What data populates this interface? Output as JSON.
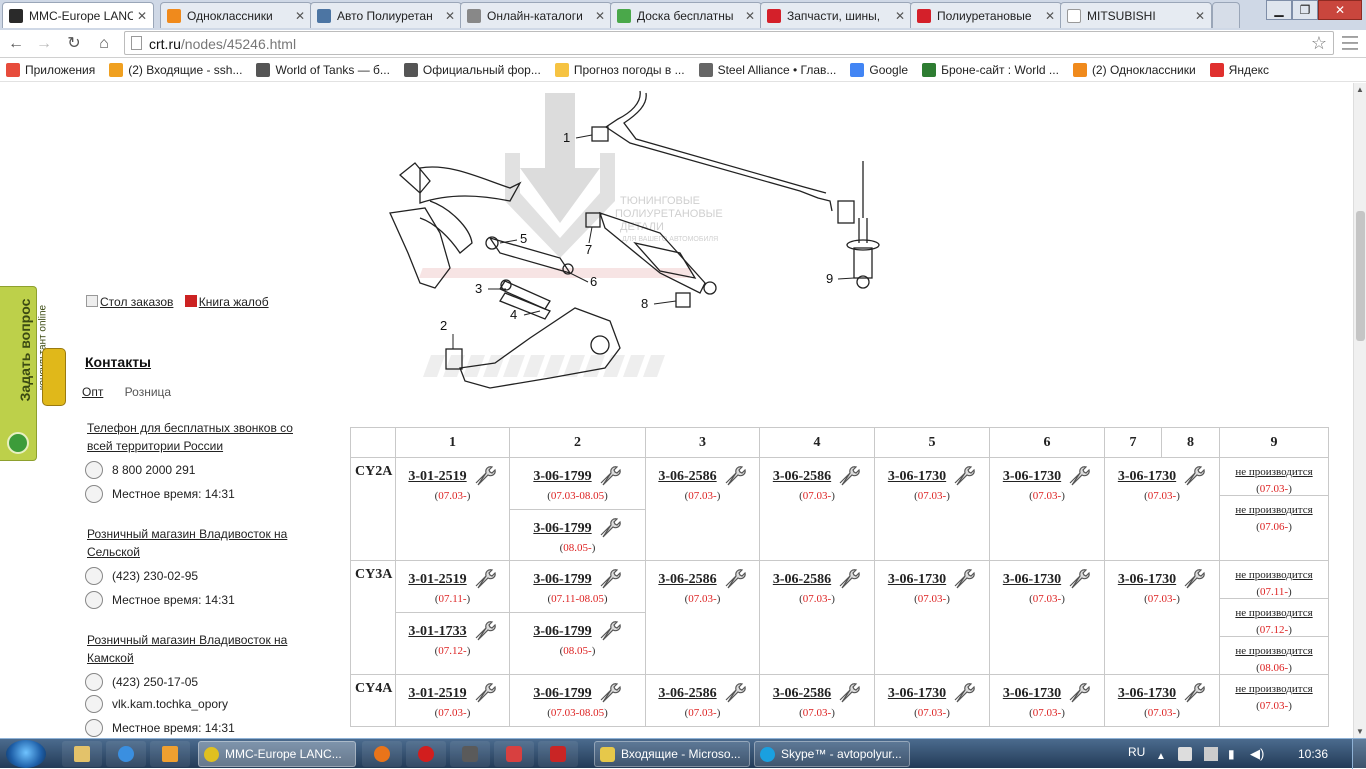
{
  "browser": {
    "tabs": [
      {
        "title": "MMC-Europe LANC",
        "icon": "tochka-icon",
        "active": true
      },
      {
        "title": "Одноклассники",
        "icon": "ok-icon"
      },
      {
        "title": "Авто Полиуретан",
        "icon": "vk-icon"
      },
      {
        "title": "Онлайн-каталоги",
        "icon": "gear-icon"
      },
      {
        "title": "Доска бесплатны",
        "icon": "board-icon"
      },
      {
        "title": "Запчасти, шины,",
        "icon": "drom-icon"
      },
      {
        "title": "Полиуретановые",
        "icon": "drom-icon"
      },
      {
        "title": "MITSUBISHI",
        "icon": "page-icon"
      }
    ],
    "url_domain": "crt.ru",
    "url_path": "/nodes/45246.html",
    "bookmarks": [
      {
        "label": "Приложения",
        "icon": "apps-icon"
      },
      {
        "label": "(2) Входящие - ssh...",
        "icon": "mail-icon"
      },
      {
        "label": "World of Tanks — б...",
        "icon": "wot-icon"
      },
      {
        "label": "Официальный фор...",
        "icon": "wot-icon"
      },
      {
        "label": "Прогноз погоды в ...",
        "icon": "weather-icon"
      },
      {
        "label": "Steel Alliance • Глав...",
        "icon": "steel-icon"
      },
      {
        "label": "Google",
        "icon": "google-icon"
      },
      {
        "label": "Броне-сайт : World ...",
        "icon": "tank-icon"
      },
      {
        "label": "(2) Одноклассники",
        "icon": "ok-icon"
      },
      {
        "label": "Яндекс",
        "icon": "yandex-icon"
      }
    ]
  },
  "sidebar": {
    "ask_title": "Задать вопрос",
    "ask_sub": "консультант online",
    "order_table": "Стол заказов",
    "complaints": "Книга жалоб",
    "contacts_heading": "Контакты",
    "tabs": [
      "Опт",
      "Розница"
    ],
    "blocks": [
      {
        "title": "Телефон для бесплатных звонков со всей территории России",
        "phone": "8 800 2000 291",
        "time": "Местное время: 14:31"
      },
      {
        "title": "Розничный магазин Владивосток на Сельской",
        "phone": "(423) 230-02-95",
        "time": "Местное время: 14:31"
      },
      {
        "title": "Розничный магазин Владивосток на Камской",
        "phone": "(423) 250-17-05",
        "skype": "vlk.kam.tochka_opory",
        "time": "Местное время: 14:31"
      }
    ]
  },
  "diagram": {
    "watermark_lines": [
      "ТЮНИНГОВЫЕ",
      "ПОЛИУРЕТАНОВЫЕ",
      "ДЕТАЛИ",
      "ДЛЯ ВАШЕГО АВТОМОБИЛЯ"
    ],
    "callouts": [
      "1",
      "2",
      "3",
      "4",
      "5",
      "6",
      "7",
      "8",
      "9"
    ]
  },
  "table": {
    "headers": [
      "",
      "1",
      "2",
      "3",
      "4",
      "5",
      "6",
      "7",
      "8",
      "9"
    ],
    "rows": [
      {
        "model": "CY2A",
        "c1": [
          {
            "pn": "3-01-2519",
            "date": "07.03-"
          }
        ],
        "c2": [
          {
            "pn": "3-06-1799",
            "date": "07.03-08.05"
          },
          {
            "pn": "3-06-1799",
            "date": "08.05-"
          }
        ],
        "c3": [
          {
            "pn": "3-06-2586",
            "date": "07.03-"
          }
        ],
        "c4": [
          {
            "pn": "3-06-2586",
            "date": "07.03-"
          }
        ],
        "c5": [
          {
            "pn": "3-06-1730",
            "date": "07.03-"
          }
        ],
        "c6": [
          {
            "pn": "3-06-1730",
            "date": "07.03-"
          }
        ],
        "c78": [
          {
            "pn": "3-06-1730",
            "date": "07.03-"
          }
        ],
        "c9": [
          {
            "pn": "не производится",
            "date": "07.03-"
          },
          {
            "pn": "не производится",
            "date": "07.06-"
          }
        ]
      },
      {
        "model": "CY3A",
        "c1": [
          {
            "pn": "3-01-2519",
            "date": "07.11-"
          },
          {
            "pn": "3-01-1733",
            "date": "07.12-"
          }
        ],
        "c2": [
          {
            "pn": "3-06-1799",
            "date": "07.11-08.05"
          },
          {
            "pn": "3-06-1799",
            "date": "08.05-"
          }
        ],
        "c3": [
          {
            "pn": "3-06-2586",
            "date": "07.03-"
          }
        ],
        "c4": [
          {
            "pn": "3-06-2586",
            "date": "07.03-"
          }
        ],
        "c5": [
          {
            "pn": "3-06-1730",
            "date": "07.03-"
          }
        ],
        "c6": [
          {
            "pn": "3-06-1730",
            "date": "07.03-"
          }
        ],
        "c78": [
          {
            "pn": "3-06-1730",
            "date": "07.03-"
          }
        ],
        "c9": [
          {
            "pn": "не производится",
            "date": "07.11-"
          },
          {
            "pn": "не производится",
            "date": "07.12-"
          },
          {
            "pn": "не производится",
            "date": "08.06-"
          }
        ]
      },
      {
        "model": "CY4A",
        "c1": [
          {
            "pn": "3-01-2519",
            "date": "07.03-"
          }
        ],
        "c2": [
          {
            "pn": "3-06-1799",
            "date": "07.03-08.05"
          }
        ],
        "c3": [
          {
            "pn": "3-06-2586",
            "date": "07.03-"
          }
        ],
        "c4": [
          {
            "pn": "3-06-2586",
            "date": "07.03-"
          }
        ],
        "c5": [
          {
            "pn": "3-06-1730",
            "date": "07.03-"
          }
        ],
        "c6": [
          {
            "pn": "3-06-1730",
            "date": "07.03-"
          }
        ],
        "c78": [
          {
            "pn": "3-06-1730",
            "date": "07.03-"
          }
        ],
        "c9": [
          {
            "pn": "не производится",
            "date": "07.03-"
          }
        ]
      }
    ]
  },
  "taskbar": {
    "items": [
      {
        "label": "MMC-Europe LANC...",
        "icon": "chrome-icon",
        "active": true
      },
      {
        "label": "Входящие - Microso...",
        "icon": "outlook-icon"
      },
      {
        "label": "Skype™ - avtopolyur...",
        "icon": "skype-icon"
      }
    ],
    "lang": "RU",
    "clock": "10:36"
  }
}
